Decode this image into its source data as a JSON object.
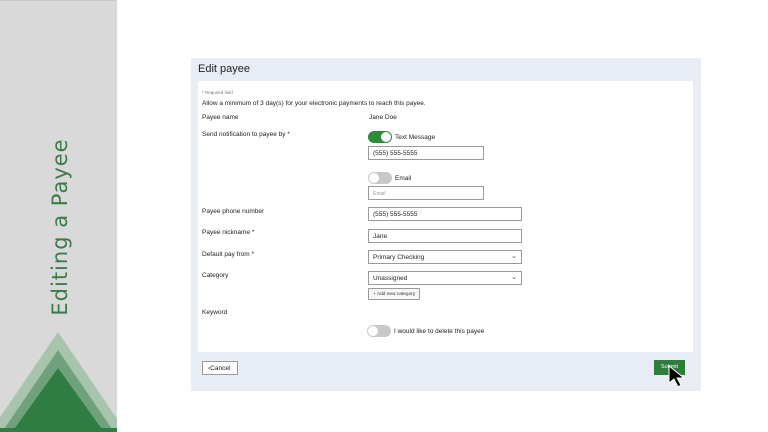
{
  "sidebar": {
    "title": "Editing a Payee"
  },
  "dialog": {
    "title": "Edit payee",
    "required_note": "* Required field",
    "allow_note": "Allow a minimum of 3 day(s) for your electronic payments to reach this payee.",
    "payee_name_label": "Payee name",
    "payee_name_value": "Jane Doe",
    "notification_label": "Send notification to payee by *",
    "text_message_label": "Text Message",
    "text_message_on": true,
    "text_message_value": "(555) 555-5555",
    "email_label": "Email",
    "email_on": false,
    "email_placeholder": "Email",
    "phone_label": "Payee phone number",
    "phone_value": "(555) 555-5555",
    "nickname_label": "Payee nickname *",
    "nickname_value": "Jane",
    "pay_from_label": "Default pay from *",
    "pay_from_value": "Primary Checking",
    "category_label": "Category",
    "category_value": "Unassigned",
    "add_category_label": "+ Add new category",
    "keyword_label": "Keyword",
    "delete_label": "I would like to delete this payee",
    "delete_on": false,
    "cancel_label": "Cancel",
    "submit_label": "Submit"
  },
  "colors": {
    "accent": "#2e8b3e",
    "panel": "#e8edf5",
    "sidebar": "#d9d9d9",
    "title_green": "#3f7a4e"
  },
  "icons": {
    "chevron": "chevron-down-icon",
    "back": "chevron-left-icon",
    "cursor": "mouse-pointer-icon"
  }
}
